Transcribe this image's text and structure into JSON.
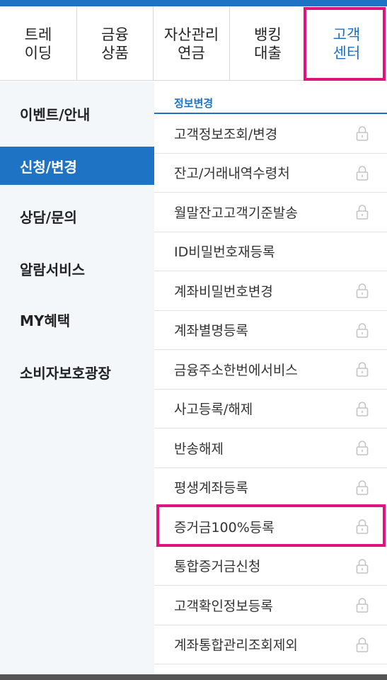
{
  "nav_tabs": [
    {
      "line1": "트레",
      "line2": "이딩",
      "active": false
    },
    {
      "line1": "금융",
      "line2": "상품",
      "active": false
    },
    {
      "line1": "자산관리",
      "line2": "연금",
      "active": false
    },
    {
      "line1": "뱅킹",
      "line2": "대출",
      "active": false
    },
    {
      "line1": "고객",
      "line2": "센터",
      "active": true
    }
  ],
  "sidebar": {
    "items": [
      {
        "label": "이벤트/안내",
        "active": false
      },
      {
        "label": "신청/변경",
        "active": true
      },
      {
        "label": "상담/문의",
        "active": false
      },
      {
        "label": "알람서비스",
        "active": false
      },
      {
        "label": "MY혜택",
        "active": false
      },
      {
        "label": "소비자보호광장",
        "active": false
      }
    ]
  },
  "content": {
    "section_title": "정보변경",
    "items": [
      {
        "label": "고객정보조회/변경",
        "locked": true
      },
      {
        "label": "잔고/거래내역수령처",
        "locked": true
      },
      {
        "label": "월말잔고고객기준발송",
        "locked": true
      },
      {
        "label": "ID비밀번호재등록",
        "locked": false
      },
      {
        "label": "계좌비밀번호변경",
        "locked": true
      },
      {
        "label": "계좌별명등록",
        "locked": true
      },
      {
        "label": "금융주소한번에서비스",
        "locked": true
      },
      {
        "label": "사고등록/해제",
        "locked": true
      },
      {
        "label": "반송해제",
        "locked": true
      },
      {
        "label": "평생계좌등록",
        "locked": true
      },
      {
        "label": "증거금100%등록",
        "locked": true
      },
      {
        "label": "통합증거금신청",
        "locked": true
      },
      {
        "label": "고객확인정보등록",
        "locked": true
      },
      {
        "label": "계좌통합관리조회제외",
        "locked": true
      }
    ]
  },
  "colors": {
    "accent": "#1f73c4",
    "highlight": "#e0147f",
    "sidebar_bg": "#f3f7fa"
  },
  "icons": {
    "lock": "lock-icon"
  }
}
